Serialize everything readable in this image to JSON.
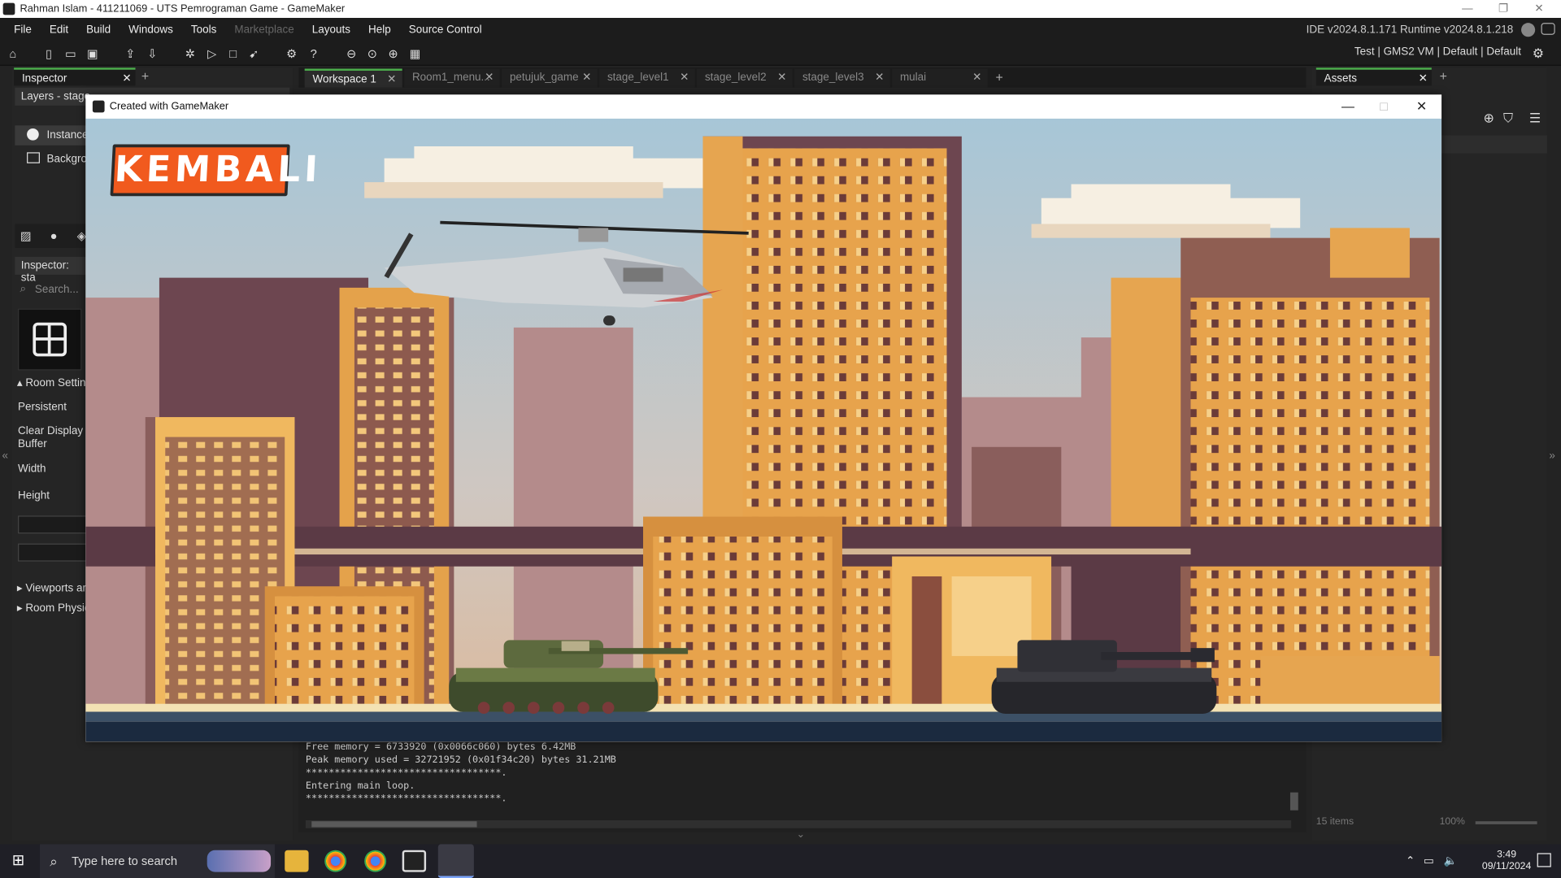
{
  "window": {
    "title": "Rahman Islam - 411211069 - UTS Pemrograman Game - GameMaker"
  },
  "menu": {
    "items": [
      "File",
      "Edit",
      "Build",
      "Windows",
      "Tools",
      "Marketplace",
      "Layouts",
      "Help",
      "Source Control"
    ],
    "disabled": [
      "Marketplace"
    ],
    "version": "IDE v2024.8.1.171  Runtime v2024.8.1.218"
  },
  "toolbar": {
    "right": "Test | GMS2 VM | Default | Default"
  },
  "left_panel": {
    "tab": "Inspector",
    "layers_label": "Layers - stage",
    "layers": [
      "Instance",
      "Backgro"
    ],
    "inspector_label": "Inspector: sta",
    "search_placeholder": "Search...",
    "room_settings": "Room Setting",
    "persistent": "Persistent",
    "clear_display_1": "Clear Display",
    "clear_display_2": "Buffer",
    "width": "Width",
    "height": "Height",
    "viewports": "Viewports ar",
    "room_physics": "Room Physic"
  },
  "workspace_tabs": [
    "Workspace 1",
    "Room1_menu...",
    "petujuk_game",
    "stage_level1",
    "stage_level2",
    "stage_level3",
    "mulai"
  ],
  "right_panel": {
    "tab": "Assets",
    "items_count": "15 items",
    "zoom": "100%"
  },
  "game_window": {
    "title": "Created with GameMaker",
    "button": "KEMBALI"
  },
  "output": [
    "Free memory = 6733920 (0x0066c060) bytes 6.42MB",
    "Peak memory used = 32721952 (0x01f34c20) bytes 31.21MB",
    "**********************************.",
    "Entering main loop.",
    "**********************************."
  ],
  "taskbar": {
    "search": "Type here to search",
    "time": "3:49",
    "date": "09/11/2024"
  }
}
